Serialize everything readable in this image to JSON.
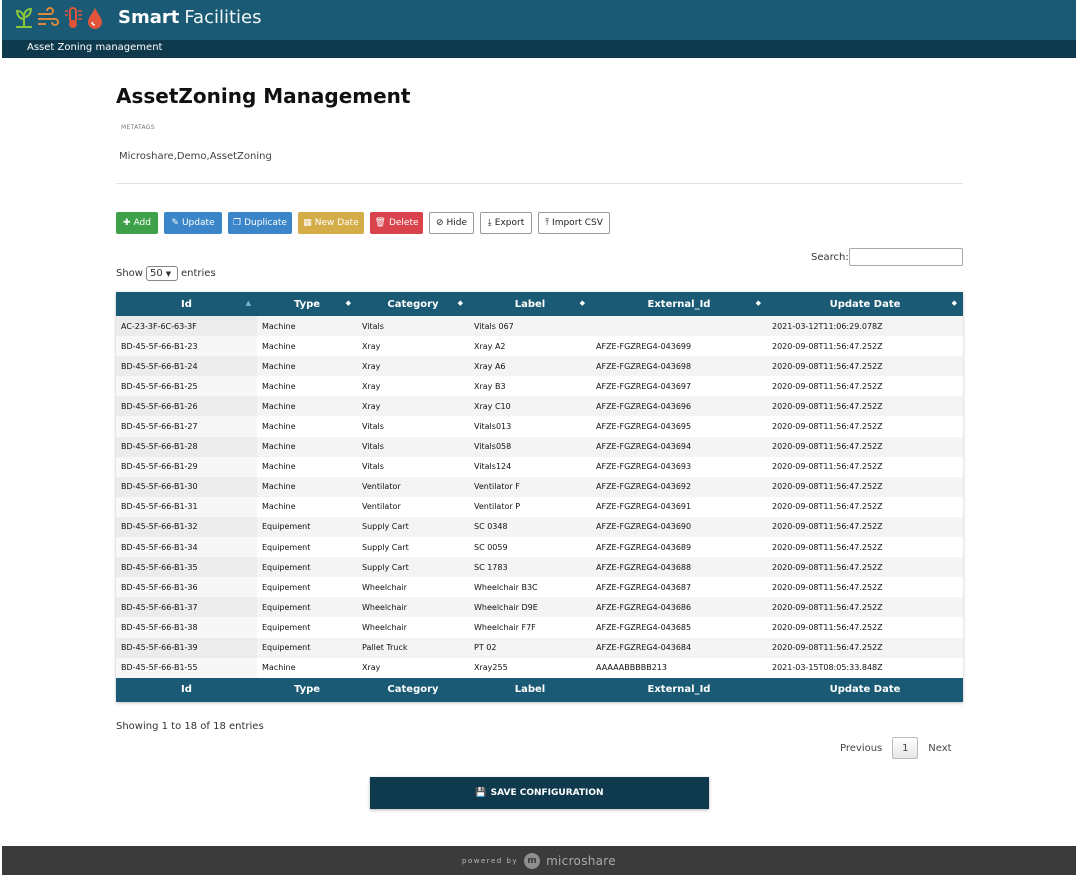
{
  "header": {
    "brand_bold": "Smart",
    "brand_light": "Facilities",
    "breadcrumb": "Asset Zoning management",
    "logo_icons": [
      "plant-icon",
      "wind-icon",
      "thermometer-icon",
      "water-drop-icon"
    ],
    "logo_colors": [
      "#8cc63f",
      "#d88a3a",
      "#e0543a",
      "#e0543a"
    ]
  },
  "main": {
    "title": "AssetZoning Management",
    "meta_label": "METATAGS",
    "meta_value": "Microshare,Demo,AssetZoning"
  },
  "toolbar": {
    "add": "Add",
    "update": "Update",
    "duplicate": "Duplicate",
    "new_date": "New Date",
    "delete": "Delete",
    "hide": "Hide",
    "export": "Export",
    "import_csv": "Import CSV"
  },
  "table_controls": {
    "show_prefix": "Show",
    "show_value": "50",
    "show_suffix": "entries",
    "search_label": "Search:",
    "search_value": ""
  },
  "table": {
    "columns": [
      "Id",
      "Type",
      "Category",
      "Label",
      "External_Id",
      "Update Date"
    ],
    "rows": [
      [
        "AC-23-3F-6C-63-3F",
        "Machine",
        "Vitals",
        "Vitals 067",
        "",
        "2021-03-12T11:06:29.078Z"
      ],
      [
        "BD-45-5F-66-B1-23",
        "Machine",
        "Xray",
        "Xray A2",
        "AFZE-FGZREG4-043699",
        "2020-09-08T11:56:47.252Z"
      ],
      [
        "BD-45-5F-66-B1-24",
        "Machine",
        "Xray",
        "Xray A6",
        "AFZE-FGZREG4-043698",
        "2020-09-08T11:56:47.252Z"
      ],
      [
        "BD-45-5F-66-B1-25",
        "Machine",
        "Xray",
        "Xray B3",
        "AFZE-FGZREG4-043697",
        "2020-09-08T11:56:47.252Z"
      ],
      [
        "BD-45-5F-66-B1-26",
        "Machine",
        "Xray",
        "Xray C10",
        "AFZE-FGZREG4-043696",
        "2020-09-08T11:56:47.252Z"
      ],
      [
        "BD-45-5F-66-B1-27",
        "Machine",
        "Vitals",
        "Vitals013",
        "AFZE-FGZREG4-043695",
        "2020-09-08T11:56:47.252Z"
      ],
      [
        "BD-45-5F-66-B1-28",
        "Machine",
        "Vitals",
        "Vitals058",
        "AFZE-FGZREG4-043694",
        "2020-09-08T11:56:47.252Z"
      ],
      [
        "BD-45-5F-66-B1-29",
        "Machine",
        "Vitals",
        "Vitals124",
        "AFZE-FGZREG4-043693",
        "2020-09-08T11:56:47.252Z"
      ],
      [
        "BD-45-5F-66-B1-30",
        "Machine",
        "Ventilator",
        "Ventilator F",
        "AFZE-FGZREG4-043692",
        "2020-09-08T11:56:47.252Z"
      ],
      [
        "BD-45-5F-66-B1-31",
        "Machine",
        "Ventilator",
        "Ventilator P",
        "AFZE-FGZREG4-043691",
        "2020-09-08T11:56:47.252Z"
      ],
      [
        "BD-45-5F-66-B1-32",
        "Equipement",
        "Supply Cart",
        "SC 0348",
        "AFZE-FGZREG4-043690",
        "2020-09-08T11:56:47.252Z"
      ],
      [
        "BD-45-5F-66-B1-34",
        "Equipement",
        "Supply Cart",
        "SC 0059",
        "AFZE-FGZREG4-043689",
        "2020-09-08T11:56:47.252Z"
      ],
      [
        "BD-45-5F-66-B1-35",
        "Equipement",
        "Supply Cart",
        "SC 1783",
        "AFZE-FGZREG4-043688",
        "2020-09-08T11:56:47.252Z"
      ],
      [
        "BD-45-5F-66-B1-36",
        "Equipement",
        "Wheelchair",
        "Wheelchair B3C",
        "AFZE-FGZREG4-043687",
        "2020-09-08T11:56:47.252Z"
      ],
      [
        "BD-45-5F-66-B1-37",
        "Equipement",
        "Wheelchair",
        "Wheelchair D9E",
        "AFZE-FGZREG4-043686",
        "2020-09-08T11:56:47.252Z"
      ],
      [
        "BD-45-5F-66-B1-38",
        "Equipement",
        "Wheelchair",
        "Wheelchair F7F",
        "AFZE-FGZREG4-043685",
        "2020-09-08T11:56:47.252Z"
      ],
      [
        "BD-45-5F-66-B1-39",
        "Equipement",
        "Pallet Truck",
        "PT 02",
        "AFZE-FGZREG4-043684",
        "2020-09-08T11:56:47.252Z"
      ],
      [
        "BD-45-5F-66-B1-55",
        "Machine",
        "Xray",
        "Xray255",
        "AAAAABBBBB213",
        "2021-03-15T08:05:33.848Z"
      ]
    ],
    "info": "Showing 1 to 18 of 18 entries"
  },
  "pagination": {
    "previous": "Previous",
    "page": "1",
    "next": "Next"
  },
  "save": {
    "label": "SAVE CONFIGURATION"
  },
  "footer": {
    "powered_by": "powered by",
    "company": "microshare"
  },
  "colors": {
    "header_bg": "#1a5a74",
    "subbar_bg": "#0f3a4d",
    "add": "#3ea049",
    "update": "#3a86c8",
    "new_date": "#d4ad48",
    "delete": "#d9434b",
    "footer_bg": "#3b3b3b"
  }
}
